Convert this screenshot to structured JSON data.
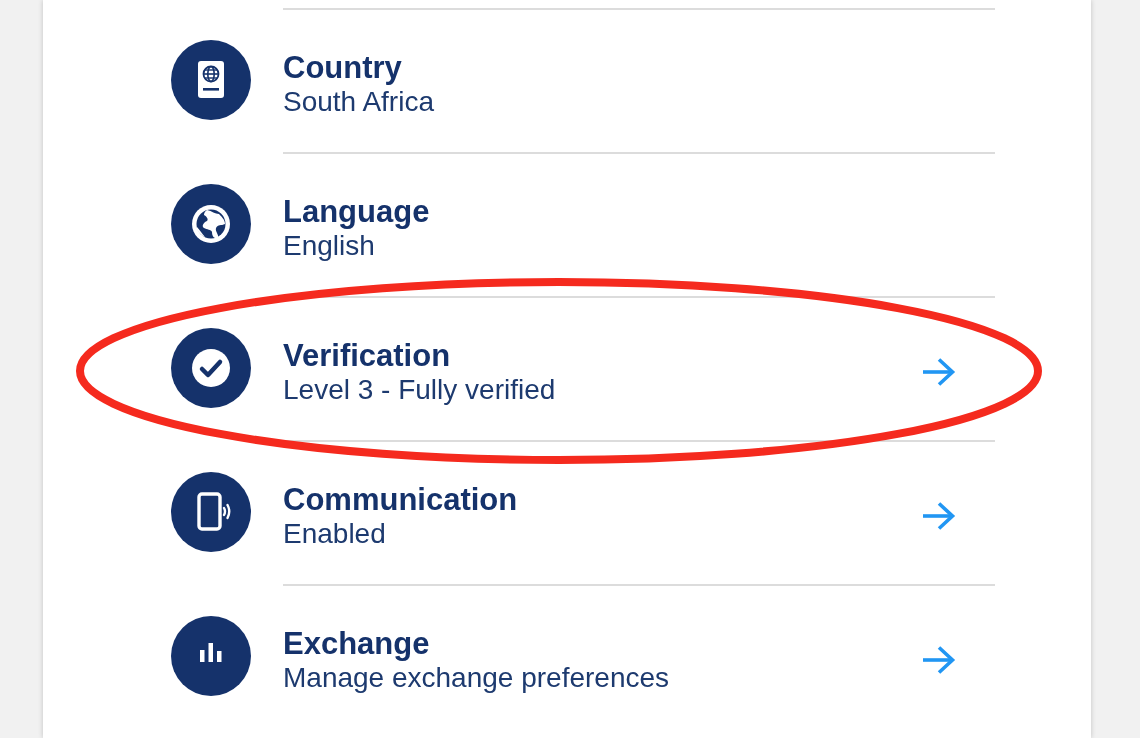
{
  "settings": {
    "rows": [
      {
        "title": "Country",
        "value": "South Africa",
        "arrow": false,
        "highlighted": false
      },
      {
        "title": "Language",
        "value": "English",
        "arrow": false,
        "highlighted": false
      },
      {
        "title": "Verification",
        "value": "Level 3 - Fully verified",
        "arrow": true,
        "highlighted": true
      },
      {
        "title": "Communication",
        "value": "Enabled",
        "arrow": true,
        "highlighted": false
      },
      {
        "title": "Exchange",
        "value": "Manage exchange preferences",
        "arrow": true,
        "highlighted": false
      }
    ]
  }
}
